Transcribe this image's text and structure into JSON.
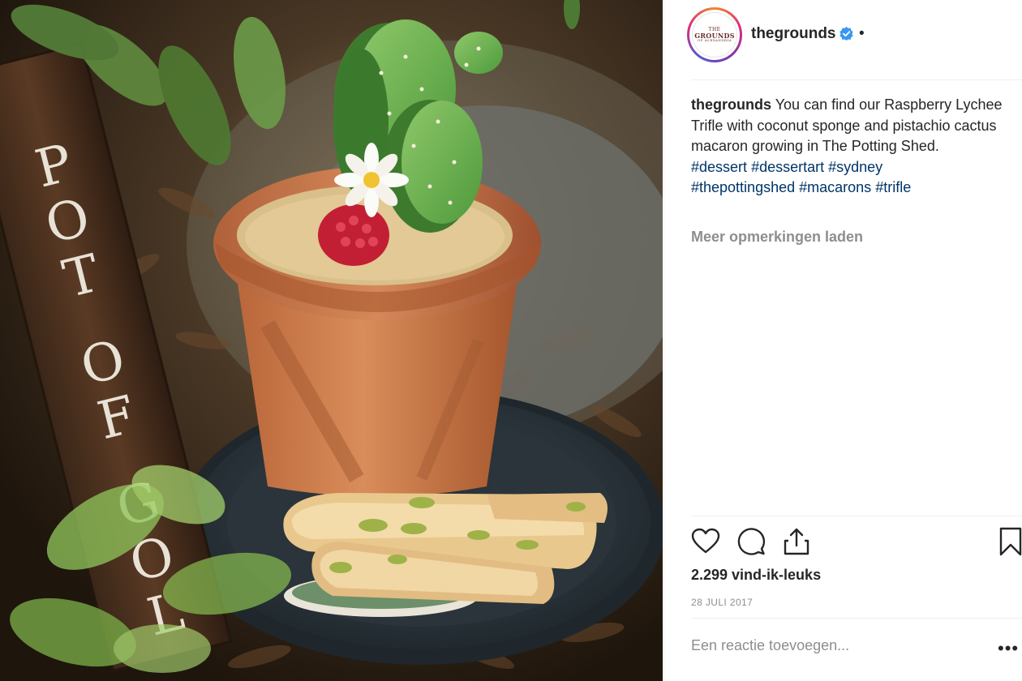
{
  "post": {
    "username": "thegrounds",
    "verified": true,
    "separator": "•",
    "avatar": {
      "logo_top": "THE",
      "logo_main": "GROUNDS",
      "logo_bottom": "OF ALEXANDRIA"
    }
  },
  "caption": {
    "username": "thegrounds",
    "text": "You can find our Raspberry Lychee Trifle with coconut sponge and pistachio cactus macaron growing in The Potting Shed.",
    "hashtags": [
      "#dessert",
      "#dessertart",
      "#sydney",
      "#thepottingshed",
      "#macarons",
      "#trifle"
    ]
  },
  "comments": {
    "load_more_label": "Meer opmerkingen laden"
  },
  "actions": {
    "like_icon": "heart-icon",
    "comment_icon": "comment-icon",
    "share_icon": "share-icon",
    "save_icon": "bookmark-icon"
  },
  "likes_label": "2.299 vind-ik-leuks",
  "date_label": "28 JULI 2017",
  "comment_box": {
    "placeholder": "Een reactie toevoegen...",
    "more_options": "•••"
  },
  "photo": {
    "sign_text": "POT OF GOLD"
  },
  "colors": {
    "verified_blue": "#3897f0",
    "hashtag_blue": "#003569",
    "muted_gray": "#8e8e8e",
    "text": "#262626"
  }
}
